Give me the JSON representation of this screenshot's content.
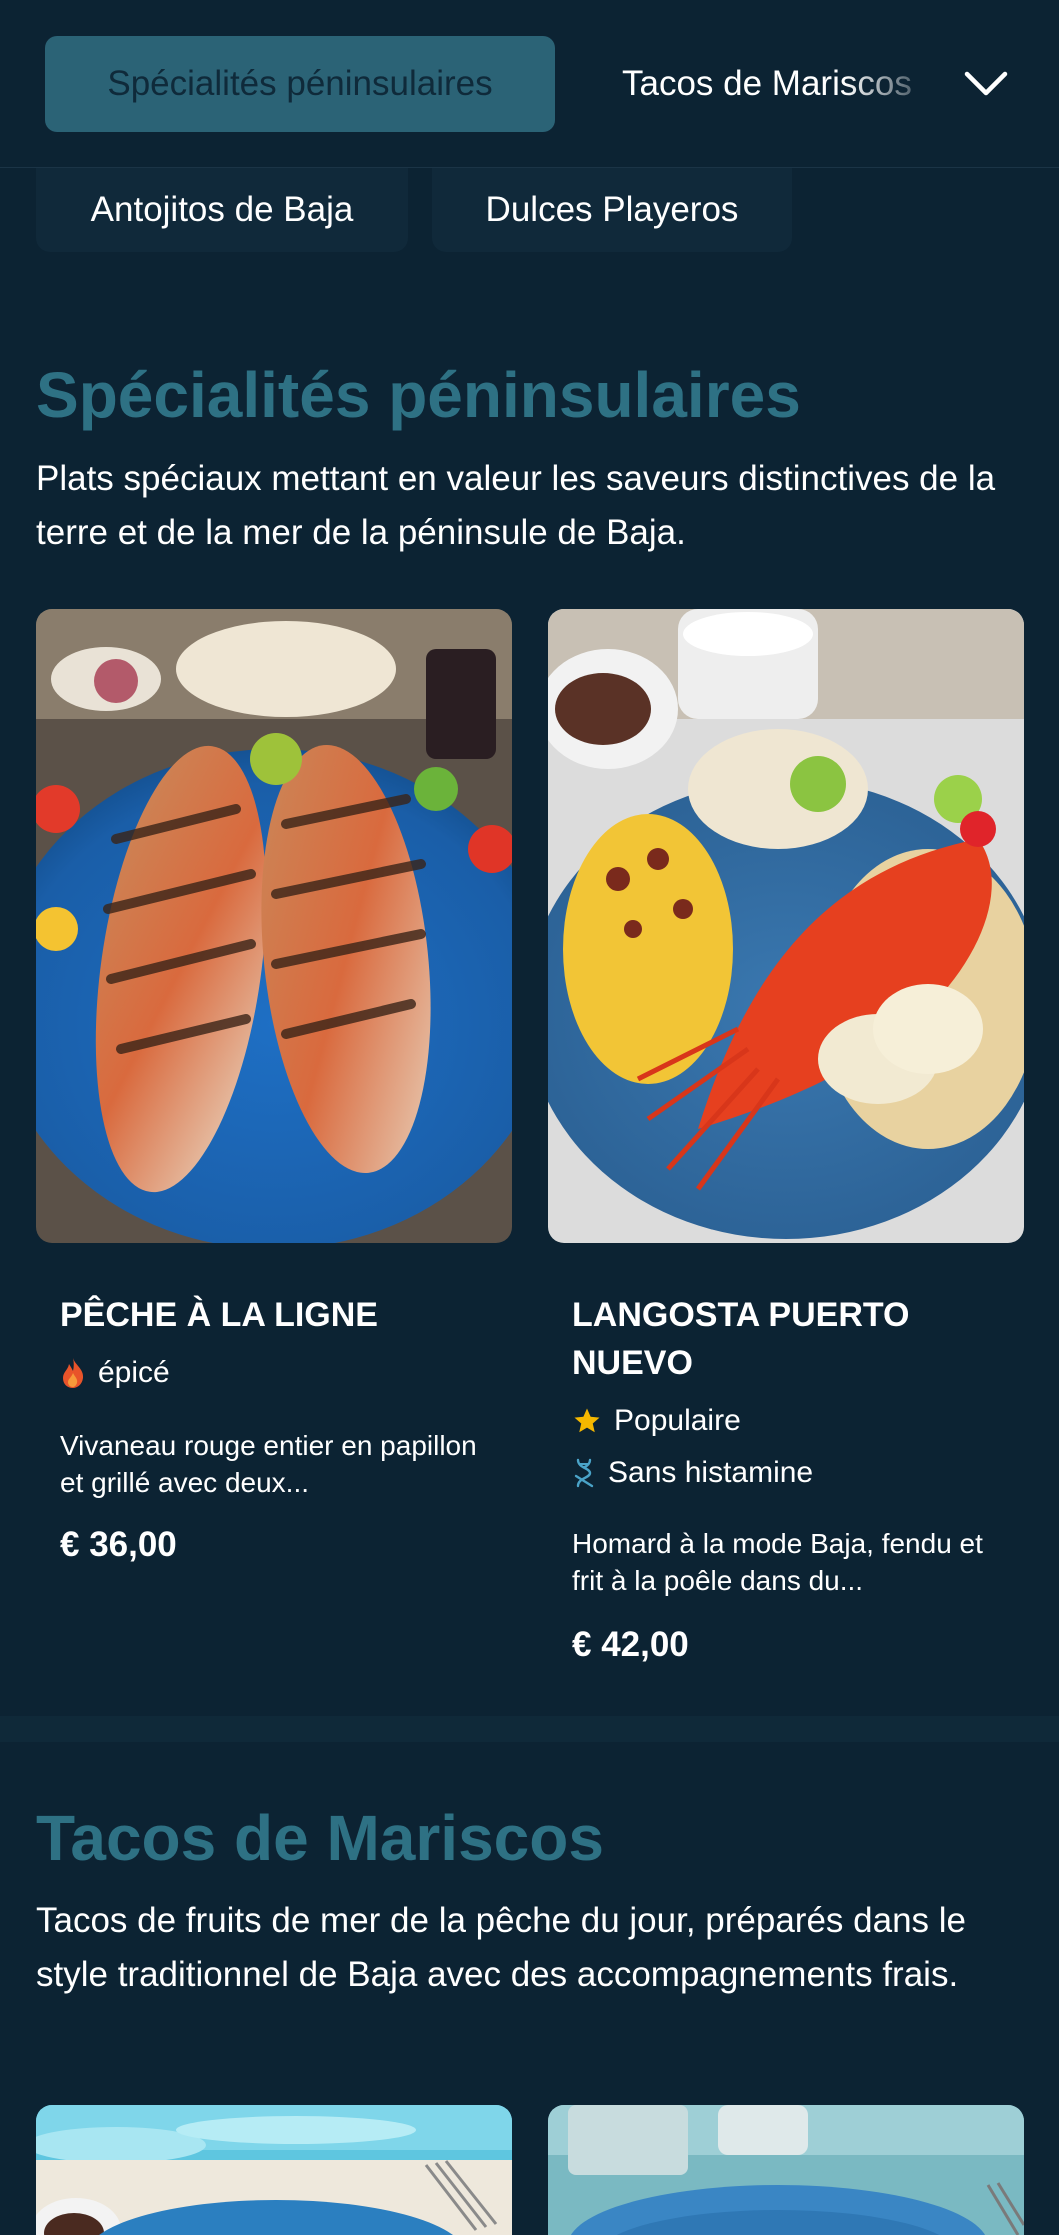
{
  "nav": {
    "active_category": "Spécialités péninsulaires",
    "next_category": "Tacos de Mariscos",
    "sub_categories": [
      "Antojitos de Baja",
      "Dulces Playeros"
    ]
  },
  "sections": [
    {
      "title": "Spécialités péninsulaires",
      "description": "Plats spéciaux mettant en valeur les saveurs distinctives de la terre et de la mer de la péninsule de Baja.",
      "items": [
        {
          "name": "PÊCHE À LA LIGNE",
          "tags": [
            {
              "icon": "flame-icon",
              "label": "épicé"
            }
          ],
          "description": "Vivaneau rouge entier en papillon et grillé avec deux...",
          "price": "€ 36,00"
        },
        {
          "name": "LANGOSTA PUERTO NUEVO",
          "tags": [
            {
              "icon": "star-icon",
              "label": "Populaire"
            },
            {
              "icon": "dna-icon",
              "label": "Sans histamine"
            }
          ],
          "description": "Homard à la mode Baja, fendu et frit à la poêle dans du...",
          "price": "€ 42,00"
        }
      ]
    },
    {
      "title": "Tacos de Mariscos",
      "description": "Tacos de fruits de mer de la pêche du jour, préparés dans le style traditionnel de Baja avec des accompagnements frais."
    }
  ],
  "colors": {
    "background": "#0c2333",
    "accent": "#2b6376",
    "section_title": "#2e7184",
    "flame": "#e8542a",
    "star": "#f5b800",
    "dna": "#4aa3c8"
  }
}
